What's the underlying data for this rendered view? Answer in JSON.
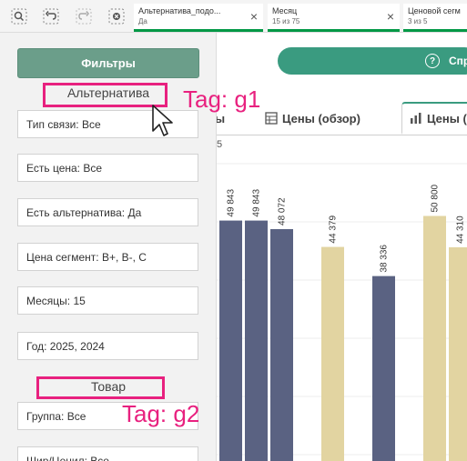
{
  "toolbar": {
    "icons": [
      "smart-search-icon",
      "step-back-icon",
      "step-forward-icon",
      "clear-selections-icon"
    ]
  },
  "selections": [
    {
      "title": "Альтернатива_подо...",
      "value": "Да",
      "close": "×"
    },
    {
      "title": "Месяц",
      "value": "15 из 75",
      "close": "×"
    },
    {
      "title": "Ценовой сегм",
      "value": "3 из 5",
      "close": ""
    }
  ],
  "panel": {
    "filters_label": "Фильтры",
    "group1_title": "Альтернатива",
    "group1_fields": [
      "Тип связи: Все",
      "Есть цена: Все",
      "Есть альтернатива: Да",
      "Цена сегмент: B+, B-, C",
      "Месяцы: 15",
      "Год: 2025, 2024"
    ],
    "group2_title": "Товар",
    "group2_fields": [
      "Группа: Все",
      "Шир/Ценил: Все"
    ]
  },
  "annotations": {
    "tag1": "Tag: g1",
    "tag2": "Tag: g2"
  },
  "main": {
    "help_label": "Спр",
    "tab_left_partial": "ы",
    "tab_overview": "Цены (обзор)",
    "tab_active": "Цены (",
    "sub_label": "5"
  },
  "chart_data": {
    "type": "bar",
    "values": [
      49843,
      49843,
      48072,
      44379,
      38336,
      50800,
      44310
    ],
    "labels": [
      "49 843",
      "49 843",
      "48 072",
      "44 379",
      "38 336",
      "50 800",
      "44 310"
    ],
    "bar_colors": [
      "#5a6282",
      "#5a6282",
      "#5a6282",
      "#e2d4a1",
      "#5a6282",
      "#e2d4a1",
      "#e2d4a1"
    ]
  },
  "colors": {
    "accent": "#009845",
    "highlight": "#e8217f",
    "filter_button": "#6b9e8a",
    "help_button": "#3a9b80",
    "bar_dark": "#5a6282",
    "bar_light": "#e2d4a1"
  }
}
